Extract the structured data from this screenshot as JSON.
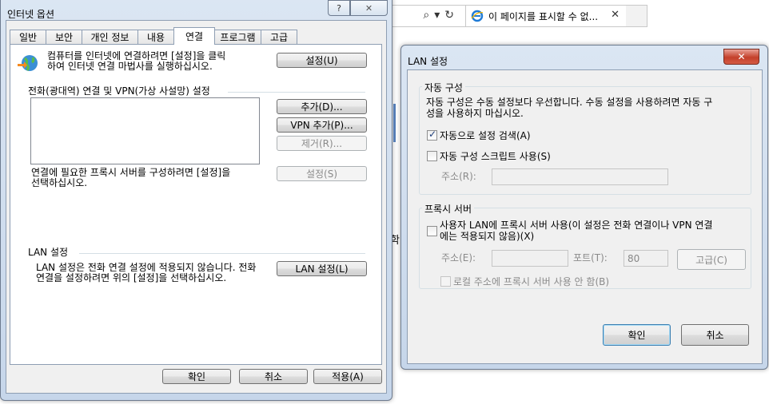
{
  "browser": {
    "tab_title": "이 페이지를 표시할 수 없...",
    "side_char": "학"
  },
  "internet_options": {
    "title": "인터넷 옵션",
    "help_label": "?",
    "tabs": [
      {
        "label": "일반"
      },
      {
        "label": "보안"
      },
      {
        "label": "개인 정보"
      },
      {
        "label": "내용"
      },
      {
        "label": "연결"
      },
      {
        "label": "프로그램"
      },
      {
        "label": "고급"
      }
    ],
    "active_tab": "연결",
    "setup_text_line1": "컴퓨터를 인터넷에 연결하려면 [설정]을 클릭",
    "setup_text_line2": "하여 인터넷 연결 마법사를 실행하십시오.",
    "setup_button": "설정(U)",
    "dialup_header": "전화(광대역) 연결 및 VPN(가상 사설망) 설정",
    "add_button": "추가(D)...",
    "add_vpn_button": "VPN 추가(P)...",
    "remove_button": "제거(R)...",
    "settings_button": "설정(S)",
    "proxy_text_line1": "연결에 필요한 프록시 서버를 구성하려면 [설정]을",
    "proxy_text_line2": "선택하십시오.",
    "lan_header": "LAN 설정",
    "lan_text_line1": "LAN 설정은 전화 연결 설정에 적용되지 않습니다. 전화",
    "lan_text_line2": "연결을 설정하려면 위의 [설정]을 선택하십시오.",
    "lan_button": "LAN 설정(L)",
    "ok_button": "확인",
    "cancel_button": "취소",
    "apply_button": "적용(A)"
  },
  "lan_settings": {
    "title": "LAN 설정",
    "auto_group": "자동 구성",
    "auto_desc_line1": "자동 구성은 수동 설정보다 우선합니다. 수동 설정을 사용하려면 자동 구",
    "auto_desc_line2": "성을 사용하지 마십시오.",
    "auto_detect_label": "자동으로 설정 검색(A)",
    "auto_detect_checked": true,
    "auto_script_label": "자동 구성 스크립트 사용(S)",
    "auto_script_checked": false,
    "address_label": "주소(R):",
    "proxy_group": "프록시 서버",
    "proxy_use_line1": "사용자 LAN에 프록시 서버 사용(이 설정은 전화 연결이나 VPN 연결",
    "proxy_use_line2": "에는 적용되지 않음)(X)",
    "proxy_use_checked": false,
    "proxy_address_label": "주소(E):",
    "port_label": "포트(T):",
    "port_value": "80",
    "advanced_button": "고급(C)",
    "bypass_label": "로컬 주소에 프록시 서버 사용 안 함(B)",
    "ok_button": "확인",
    "cancel_button": "취소"
  }
}
